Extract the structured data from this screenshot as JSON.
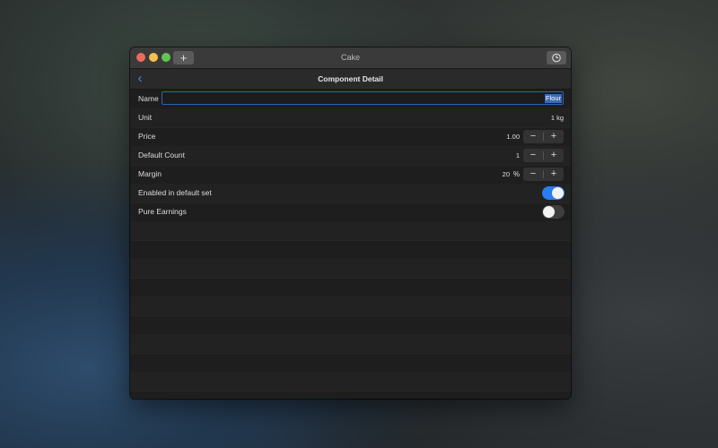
{
  "window": {
    "title": "Cake",
    "add_icon": "plus-icon",
    "add_label": "+",
    "settings_icon": "settings-clock-icon"
  },
  "navbar": {
    "back_icon": "chevron-left-icon",
    "back_label": "‹",
    "title": "Component Detail"
  },
  "form": {
    "name": {
      "label": "Name",
      "value": "Flour"
    },
    "unit": {
      "label": "Unit",
      "value": "1 kg"
    },
    "price": {
      "label": "Price",
      "value": "1.00"
    },
    "default_count": {
      "label": "Default Count",
      "value": "1"
    },
    "margin": {
      "label": "Margin",
      "value": "20",
      "unit": "%"
    },
    "enabled_default": {
      "label": "Enabled in default set",
      "on": true
    },
    "pure_earnings": {
      "label": "Pure Earnings",
      "on": false
    },
    "stepper_minus": "−",
    "stepper_plus": "+"
  },
  "colors": {
    "accent": "#2b7df0",
    "window_bg": "#1e1e1e",
    "titlebar_bg": "#3a3a3a"
  }
}
